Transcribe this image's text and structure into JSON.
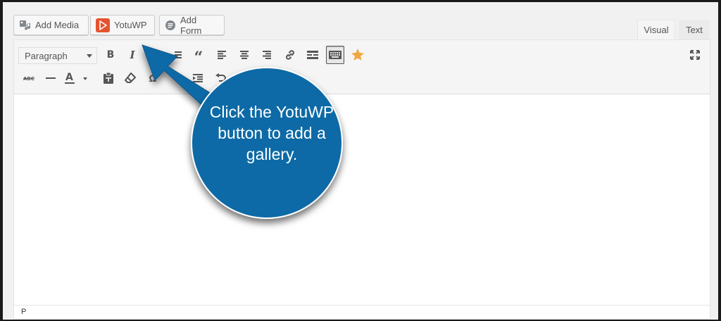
{
  "media_buttons": {
    "add_media": "Add Media",
    "yotuwp": "YotuWP",
    "add_form": "Add Form"
  },
  "tabs": {
    "visual": "Visual",
    "text": "Text"
  },
  "toolbar": {
    "format_select_value": "Paragraph",
    "row1_icons": [
      "bold-icon",
      "italic-icon",
      "strikethrough-icon",
      "blockquote-icon",
      "align-left-icon",
      "align-center-icon",
      "align-right-icon",
      "link-icon",
      "read-more-icon",
      "toolbar-toggle-icon",
      "star-icon",
      "fullscreen-icon"
    ],
    "row2_icons": [
      "strikethrough-abc-icon",
      "horizontal-line-icon",
      "text-color-icon",
      "paste-text-icon",
      "clear-formatting-icon",
      "special-character-icon",
      "indent-icon",
      "undo-icon"
    ]
  },
  "editor": {
    "status_path": "P"
  },
  "callout": {
    "text": "Click the YotuWP button to add a gallery.",
    "color": "#0e6aa6"
  },
  "colors": {
    "yotuwp_brand": "#e5532e",
    "star": "#f0a742",
    "background": "#f1f1f1"
  }
}
